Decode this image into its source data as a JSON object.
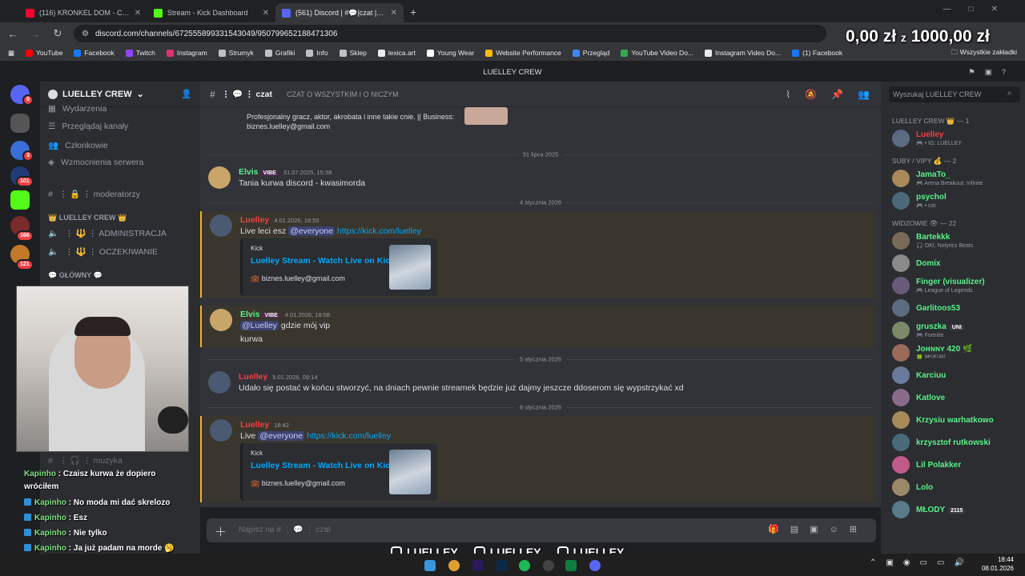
{
  "browser": {
    "tabs": [
      {
        "title": "(116) KRONKEL DOM - CHU",
        "color": "#ff0033",
        "active": false
      },
      {
        "title": "Stream - Kick Dashboard",
        "color": "#53fc18",
        "active": false
      },
      {
        "title": "(561) Discord | #💬|czat | LUEL",
        "color": "#5865f2",
        "active": true
      }
    ],
    "new_tab": "+",
    "url": "discord.com/channels/672555899331543049/950799652188471306",
    "bookmarks": [
      {
        "label": "YouTube",
        "color": "#ff0000"
      },
      {
        "label": "Facebook",
        "color": "#1877f2"
      },
      {
        "label": "Twitch",
        "color": "#9146ff"
      },
      {
        "label": "Instagram",
        "color": "#e1306c"
      },
      {
        "label": "Strumyk",
        "color": "#bdc1c6"
      },
      {
        "label": "Grafiki",
        "color": "#bdc1c6"
      },
      {
        "label": "Info",
        "color": "#bdc1c6"
      },
      {
        "label": "Sklep",
        "color": "#bdc1c6"
      },
      {
        "label": "lexica.art",
        "color": "#e8eaed"
      },
      {
        "label": "Young Wear",
        "color": "#ffffff"
      },
      {
        "label": "Website Performance",
        "color": "#fbbc04"
      },
      {
        "label": "Przegląd",
        "color": "#4285f4"
      },
      {
        "label": "YouTube Video Do...",
        "color": "#34a853"
      },
      {
        "label": "Instagram Video Do...",
        "color": "#e8eaed"
      },
      {
        "label": "(1) Facebook",
        "color": "#1877f2"
      }
    ],
    "all_bookmarks": "Wszystkie zakładki"
  },
  "overlay": {
    "money": "0,00 zł",
    "money_sep": "z",
    "money_goal": "1000,00 zł"
  },
  "discord": {
    "window_title": "LUELLEY CREW",
    "server_name": "LUELLEY CREW",
    "server_badges": [
      "5",
      "3",
      "101",
      "166",
      "121"
    ],
    "channel_items": [
      {
        "label": "Wydarzenia",
        "icon": "calendar-icon"
      },
      {
        "label": "Przeglądaj kanały",
        "icon": "browse-icon"
      },
      {
        "label": "Członkowie",
        "icon": "members-icon"
      },
      {
        "label": "Wzmocnienia serwera",
        "icon": "boost-icon"
      }
    ],
    "moderatorzy": "⋮ 🔒 ⋮ moderatorzy",
    "category_crew": "👑 LUELLEY CREW 👑",
    "administracja": "⋮ 🔱 ⋮ ADMINISTRACJA",
    "oczekiwanie": "⋮ 🔱 ⋮ OCZEKIWANIE",
    "category_glowny": "💬 GŁÓWNY 💬",
    "muzyka": "⋮ 🎧 ⋮ muzyka",
    "channel": {
      "name": "⋮ 💬 ⋮ czat",
      "topic": "CZAT O WSZYSTKIM I O NICZYM"
    },
    "search_placeholder": "Wyszukaj LUELLEY CREW",
    "top_message": {
      "text": "Profesjonalny gracz, aktor, akrobata i inne takie cnie. || Business:",
      "email": "biznes.luelley@gmail.com"
    },
    "separators": [
      "31 lipca 2025",
      "4 stycznia 2026",
      "5 stycznia 2026",
      "8 stycznia 2026"
    ],
    "messages": [
      {
        "author": "Elvis",
        "tag": "VIBE",
        "time": "31.07.2025, 15:38",
        "text": "Tania kurwa discord - kwasimorda",
        "color": "#57f287"
      },
      {
        "author": "Luelley",
        "time": "4.01.2026, 18:50",
        "text": "Live leci esz",
        "mention": "@everyone",
        "link": "https://kick.com/luelley",
        "color": "#f23f43",
        "embed": {
          "provider": "Kick",
          "title": "Luelley Stream - Watch Live on Kick",
          "desc": "💼 biznes.luelley@gmail.com"
        }
      },
      {
        "author": "Elvis",
        "tag": "VIBE",
        "time": "4.01.2026, 18:58",
        "mention": "@Luelley",
        "text": "gdzie mój vip",
        "text2": "kurwa",
        "color": "#57f287"
      },
      {
        "author": "Luelley",
        "time": "5.01.2026, 09:14",
        "text": "Udało się postać w końcu stworzyć, na dniach pewnie streamek będzie już dajmy jeszcze ddoserom się wypstrzykać xd",
        "color": "#f23f43"
      },
      {
        "author": "Luelley",
        "time": "18:42",
        "text": "Live",
        "mention": "@everyone",
        "link": "https://kick.com/luelley",
        "color": "#f23f43",
        "embed": {
          "provider": "Kick",
          "title": "Luelley Stream - Watch Live on Kick",
          "desc": "💼 biznes.luelley@gmail.com"
        }
      }
    ],
    "composer_placeholder": "Napisz na # ⋮ 💬 ⋮ czat",
    "member_groups": [
      {
        "title": "LUELLEY CREW 👑 — 1",
        "members": [
          {
            "name": "Luelley",
            "status": "🎮 • IG: LUELLEY",
            "color": "#f23f43"
          }
        ]
      },
      {
        "title": "SUBY / VIPY 💰 — 2",
        "members": [
          {
            "name": "JamaTo_",
            "status": "🎮 Arena Breakout: Infinite",
            "color": "#57f287"
          },
          {
            "name": "psychol",
            "status": "🎮 • cat",
            "color": "#57f287"
          }
        ]
      },
      {
        "title": "WIDZOWIE 👁 — 22",
        "members": [
          {
            "name": "Bartekkk",
            "status": "🎧 OKI, Nolyrics Beats",
            "color": "#57f287"
          },
          {
            "name": "Domix",
            "status": "",
            "color": "#57f287"
          },
          {
            "name": "Finger (visualizer)",
            "status": "🎮 League of Legends",
            "color": "#57f287"
          },
          {
            "name": "Garlitoos53",
            "status": "",
            "color": "#57f287"
          },
          {
            "name": "gruszka",
            "tag": "UNI",
            "status": "🎮 Fortnite",
            "color": "#57f287"
          },
          {
            "name": "Jᴏʜɴɴʏ 420 🌿",
            "status": "🍀 ᴵᴹᴾᴼᴿᵀᴬᴺᵀ",
            "color": "#57f287"
          },
          {
            "name": "Karciuu",
            "status": "",
            "color": "#57f287"
          },
          {
            "name": "Katlove",
            "status": "",
            "color": "#57f287"
          },
          {
            "name": "Krzysiu warhatkowo",
            "status": "",
            "color": "#57f287"
          },
          {
            "name": "krzysztof rutkowski",
            "status": "",
            "color": "#57f287"
          },
          {
            "name": "Lil Polakker",
            "status": "",
            "color": "#57f287"
          },
          {
            "name": "Lolo",
            "status": "",
            "color": "#57f287"
          },
          {
            "name": "MŁODY",
            "tag": "2115",
            "status": "",
            "color": "#57f287"
          }
        ]
      }
    ]
  },
  "twitch_chat": [
    {
      "user": "Kapinho",
      "text": ": Czaisz kurwa że dopiero wróciłem"
    },
    {
      "user": "Kapinho",
      "text": ": No moda mi dać skrelozo"
    },
    {
      "user": "Kapinho",
      "text": ": Esz"
    },
    {
      "user": "Kapinho",
      "text": ": Nie tylko"
    },
    {
      "user": "Kapinho",
      "text": ": Ja już padam na morde 🥱"
    }
  ],
  "socials": [
    {
      "icon": "instagram-icon",
      "label": "LUELLEY"
    },
    {
      "icon": "kick-icon",
      "label": "LUELLEY"
    },
    {
      "icon": "youtube-icon",
      "label": "LUELLEY"
    }
  ],
  "clock": {
    "time": "18:44",
    "date": "08.01.2026"
  }
}
